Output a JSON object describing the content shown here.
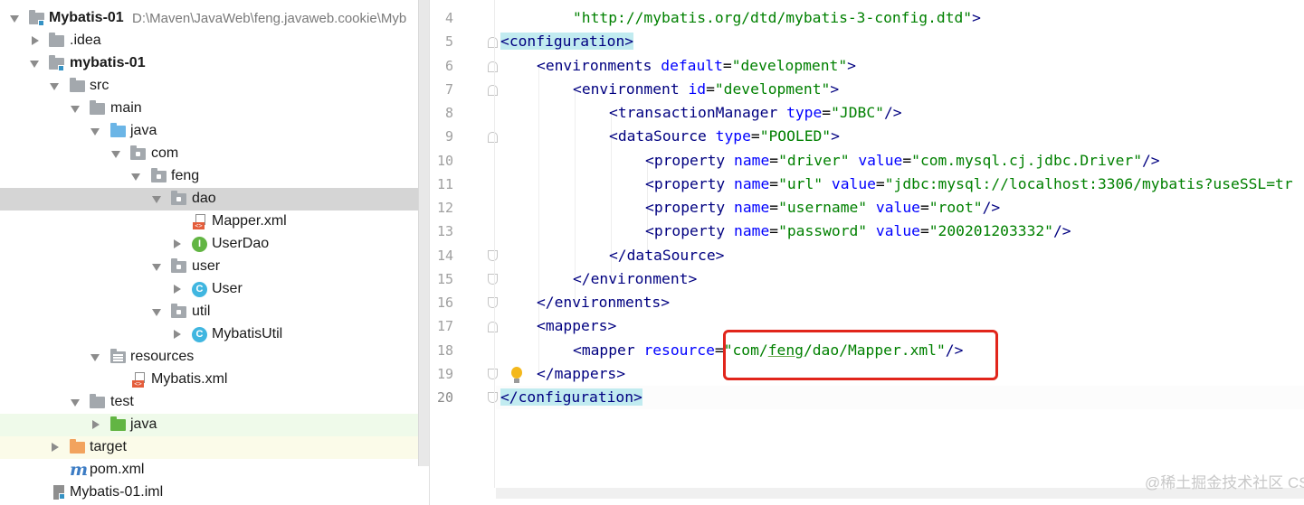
{
  "project_tree": {
    "root": {
      "label": "Mybatis-01",
      "path": "D:\\Maven\\JavaWeb\\feng.javaweb.cookie\\Myb"
    },
    "items": [
      {
        "label": ".idea"
      },
      {
        "label": "mybatis-01"
      },
      {
        "label": "src"
      },
      {
        "label": "main"
      },
      {
        "label": "java"
      },
      {
        "label": "com"
      },
      {
        "label": "feng"
      },
      {
        "label": "dao"
      },
      {
        "label": "Mapper.xml"
      },
      {
        "label": "UserDao",
        "badge": "I"
      },
      {
        "label": "user"
      },
      {
        "label": "User",
        "badge": "C"
      },
      {
        "label": "util"
      },
      {
        "label": "MybatisUtil",
        "badge": "C"
      },
      {
        "label": "resources"
      },
      {
        "label": "Mybatis.xml"
      },
      {
        "label": "test"
      },
      {
        "label": "java"
      },
      {
        "label": "target"
      },
      {
        "label": "pom.xml",
        "badge": "m"
      },
      {
        "label": "Mybatis-01.iml"
      }
    ]
  },
  "editor": {
    "xml_tag_glyph": "<>",
    "line_numbers": [
      "4",
      "5",
      "6",
      "7",
      "8",
      "9",
      "10",
      "11",
      "12",
      "13",
      "14",
      "15",
      "16",
      "17",
      "18",
      "19",
      "20"
    ],
    "lines": {
      "l4": {
        "val": "\"http://mybatis.org/dtd/mybatis-3-config.dtd\"",
        "close": ">"
      },
      "l5": {
        "open": "<",
        "tag": "configuration",
        "close": ">"
      },
      "l6": {
        "open": "<",
        "tag": "environments",
        "attr": "default",
        "eq": "=",
        "val": "\"development\"",
        "close": ">"
      },
      "l7": {
        "open": "<",
        "tag": "environment",
        "attr": "id",
        "eq": "=",
        "val": "\"development\"",
        "close": ">"
      },
      "l8": {
        "open": "<",
        "tag": "transactionManager",
        "attr": "type",
        "eq": "=",
        "val": "\"JDBC\"",
        "close": "/>"
      },
      "l9": {
        "open": "<",
        "tag": "dataSource",
        "attr": "type",
        "eq": "=",
        "val": "\"POOLED\"",
        "close": ">"
      },
      "l10": {
        "open": "<",
        "tag": "property",
        "attr": "name",
        "eq": "=",
        "val": "\"driver\"",
        "attr2": "value",
        "val2": "\"com.mysql.cj.jdbc.Driver\"",
        "close": "/>"
      },
      "l11": {
        "open": "<",
        "tag": "property",
        "attr": "name",
        "eq": "=",
        "val": "\"url\"",
        "attr2": "value",
        "val2": "\"jdbc:mysql://localhost:3306/mybatis?useSSL=tr"
      },
      "l12": {
        "open": "<",
        "tag": "property",
        "attr": "name",
        "eq": "=",
        "val": "\"username\"",
        "attr2": "value",
        "val2": "\"root\"",
        "close": "/>"
      },
      "l13": {
        "open": "<",
        "tag": "property",
        "attr": "name",
        "eq": "=",
        "val": "\"password\"",
        "attr2": "value",
        "val2": "\"200201203332\"",
        "close": "/>"
      },
      "l14": {
        "open": "</",
        "tag": "dataSource",
        "close": ">"
      },
      "l15": {
        "open": "</",
        "tag": "environment",
        "close": ">"
      },
      "l16": {
        "open": "</",
        "tag": "environments",
        "close": ">"
      },
      "l17": {
        "open": "<",
        "tag": "mappers",
        "close": ">"
      },
      "l18": {
        "open": "<",
        "tag": "mapper",
        "attr": "resource",
        "eq": "=",
        "q1": "\"",
        "v1": "com/",
        "v2": "feng",
        "v3": "/dao/Mapper.xml",
        "q2": "\"",
        "close": "/>"
      },
      "l19": {
        "open": "</",
        "tag": "mappers",
        "close": ">"
      },
      "l20": {
        "open": "</",
        "tag": "configuration",
        "close": ">"
      }
    }
  },
  "watermark": "@稀土掘金技术社区  CSDN @游逍乙",
  "colors": {
    "tag": "#000080",
    "attribute": "#0000ff",
    "value": "#008000",
    "selected_row": "#d5d5d5",
    "tag_match_highlight": "#c1ebf0",
    "annotation_box": "#e1251b"
  }
}
